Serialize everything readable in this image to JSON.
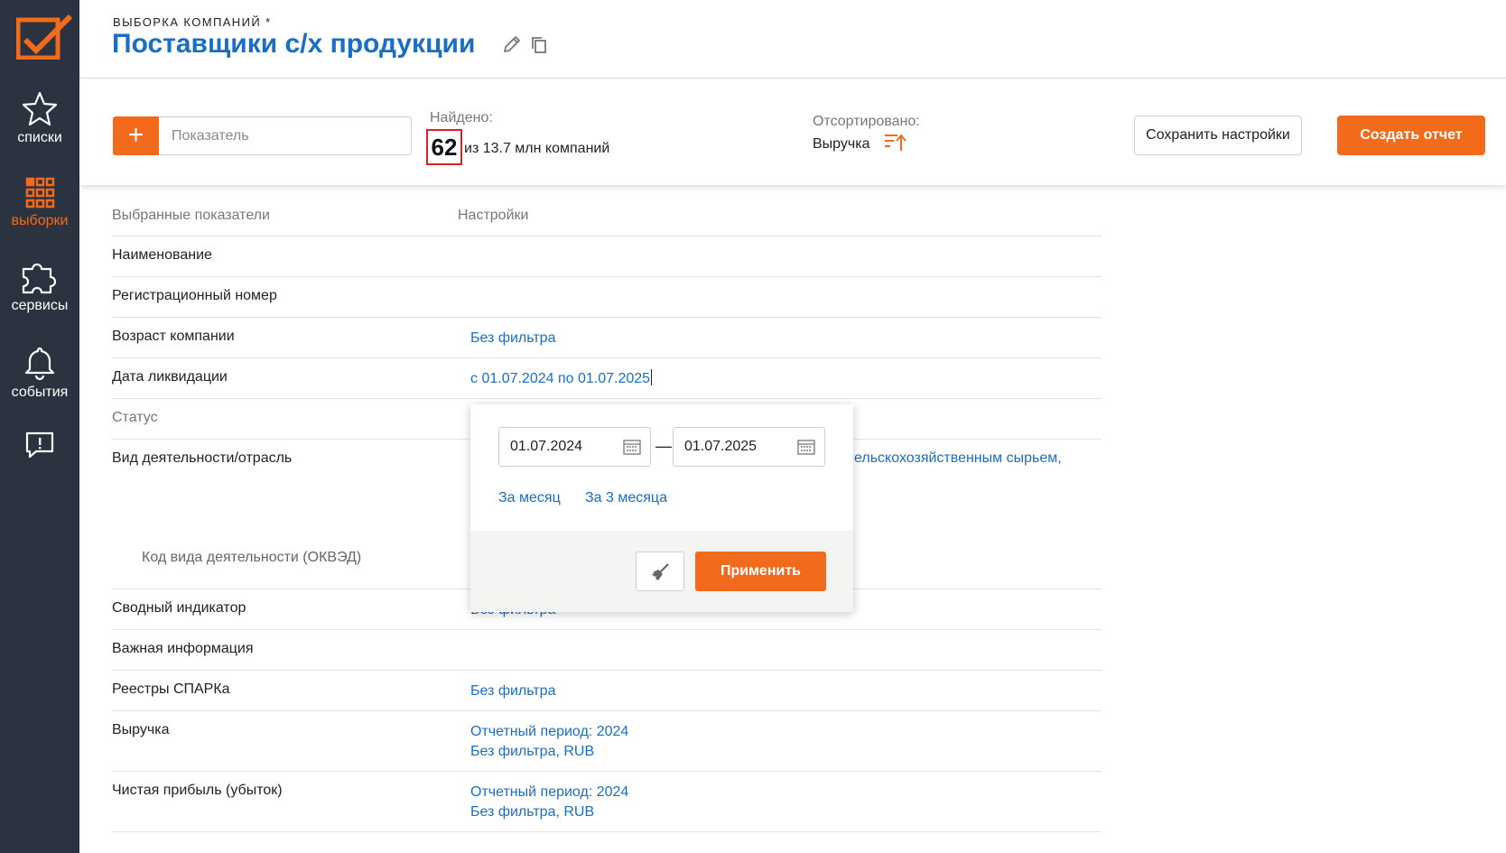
{
  "sidebar": {
    "items": [
      {
        "label": "списки",
        "icon": "star-icon"
      },
      {
        "label": "выборки",
        "icon": "grid-icon",
        "active": true
      },
      {
        "label": "сервисы",
        "icon": "puzzle-icon"
      },
      {
        "label": "события",
        "icon": "bell-icon"
      },
      {
        "label": "",
        "icon": "feedback-icon"
      }
    ]
  },
  "header": {
    "subtitle": "ВЫБОРКА КОМПАНИЙ *",
    "title": "Поставщики с/х продукции"
  },
  "toolbar": {
    "add_label": "+",
    "indicator_placeholder": "Показатель",
    "found_label": "Найдено:",
    "found_count": "62",
    "found_rest": "из 13.7 млн компаний",
    "sorted_label": "Отсортировано:",
    "sorted_value": "Выручка",
    "save_label": "Сохранить настройки",
    "report_label": "Создать отчет"
  },
  "table": {
    "col_indicators": "Выбранные показатели",
    "col_settings": "Настройки",
    "rows": [
      {
        "name": "Наименование",
        "value": ""
      },
      {
        "name": "Регистрационный номер",
        "value": ""
      },
      {
        "name": "Возраст компании",
        "value": "Без фильтра"
      },
      {
        "name": "Дата ликвидации",
        "value": "с 01.07.2024 по 01.07.2025"
      },
      {
        "name": "Статус",
        "value": ""
      },
      {
        "name": "Вид деятельности/отрасль",
        "value": "ельскохозяйственным сырьем,"
      },
      {
        "name": "Код вида деятельности (ОКВЭД)",
        "value": ""
      },
      {
        "name": "Сводный индикатор",
        "value": "Без фильтра"
      },
      {
        "name": "Важная информация",
        "value": ""
      },
      {
        "name": "Реестры СПАРКа",
        "value": "Без фильтра"
      },
      {
        "name": "Выручка",
        "value": "Отчетный период: 2024",
        "value2": "Без фильтра, RUB"
      },
      {
        "name": "Чистая прибыль (убыток)",
        "value": "Отчетный период: 2024",
        "value2": "Без фильтра, RUB"
      }
    ]
  },
  "date_popup": {
    "from": "01.07.2024",
    "to": "01.07.2025",
    "dash": "—",
    "quick_month": "За месяц",
    "quick_3months": "За 3 месяца",
    "apply_label": "Применить"
  },
  "colors": {
    "accent": "#f26b1d",
    "link": "#1a6fc4",
    "sidebar": "#2b3340"
  }
}
